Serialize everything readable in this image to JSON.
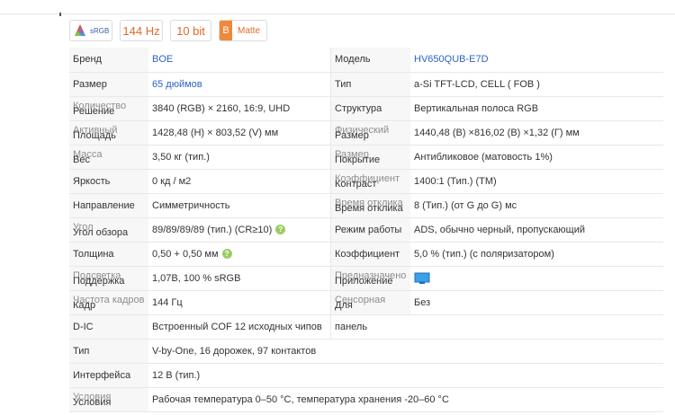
{
  "badges": {
    "srgb": "sRGB",
    "refresh": "144 Hz",
    "bit": "10 bit",
    "matte_letter": "B",
    "matte": "Matte"
  },
  "rows": [
    {
      "k1": "Бренд",
      "v1": "BOE",
      "k2": "Модель",
      "v2": "HV650QUB-E7D"
    },
    {
      "k1": "Размер",
      "v1": "65 дюймов",
      "k2": "Тип",
      "v2": "a-Si TFT-LCD, CELL ( FOB )"
    },
    {
      "k1a": "Количество",
      "k1b": "Решение",
      "v1": "3840 (RGB) × 2160, 16:9, UHD",
      "k2": "Структура",
      "v2": "Вертикальная полоса RGB"
    },
    {
      "k1a": "Активный",
      "k1b": "Площадь",
      "v1": "1428,48 (H) × 803,52 (V) мм",
      "k2a": "Физический",
      "k2b": "Размер",
      "v2": "1440,48 (В) ×816,02 (В) ×1,32 (Г) мм"
    },
    {
      "k1a": "Масса",
      "k1b": "Вес",
      "v1": "3,50 кг (тип.)",
      "k2a": "Размер",
      "k2b": "Покрытие",
      "v2": "Антибликовое (матовость 1%)"
    },
    {
      "k1": "Яркость",
      "v1": "0 кд / м2",
      "k2a": "Коэффициент",
      "k2b": "Контраст",
      "v2": "1400:1 (Тип.) (TM)"
    },
    {
      "k1": "Направление",
      "v1": "Симметричность",
      "k2a": "Время отклика",
      "k2b": "Время отклика",
      "v2": "8 (Тип.) (от G до G) мс"
    },
    {
      "k1a": "Угол",
      "k1b": "Угол обзора",
      "v1": "89/89/89/89 (тип.) (CR≥10)",
      "k2": "Режим работы",
      "v2": "ADS, обычно черный, пропускающий"
    },
    {
      "k1": "Толщина",
      "v1": "0,50 + 0,50 мм",
      "k2": "Коэффициент",
      "v2": "5,0 % (тип.) (с поляризатором)"
    },
    {
      "k1a": "Подсветка",
      "k1b": "Поддержка",
      "v1": "1,07B, 100 % sRGB",
      "k2a": "Предназначено",
      "k2b": "Приложение",
      "v2": ""
    },
    {
      "k1a": "Частота кадров",
      "k1b": "Кадр",
      "v1": "144 Гц",
      "k2a": "Сенсорная",
      "k2b": "Для",
      "v2": "Без"
    },
    {
      "k1": "D-IC",
      "v1": "Встроенный COF 12 исходных чипов",
      "k2": "панель",
      "v2": ""
    },
    {
      "k1": "Тип",
      "v1": "V-by-One, 16 дорожек, 97 контактов",
      "k2": "",
      "v2": ""
    },
    {
      "k1": "Интерфейса",
      "v1": "12 В (тип.)",
      "k2": "",
      "v2": ""
    },
    {
      "k1a": "Условия",
      "k1b": "Условия",
      "v1": "Рабочая температура 0–50 °C, температура хранения -20–60 °C",
      "k2": "",
      "v2": ""
    }
  ]
}
